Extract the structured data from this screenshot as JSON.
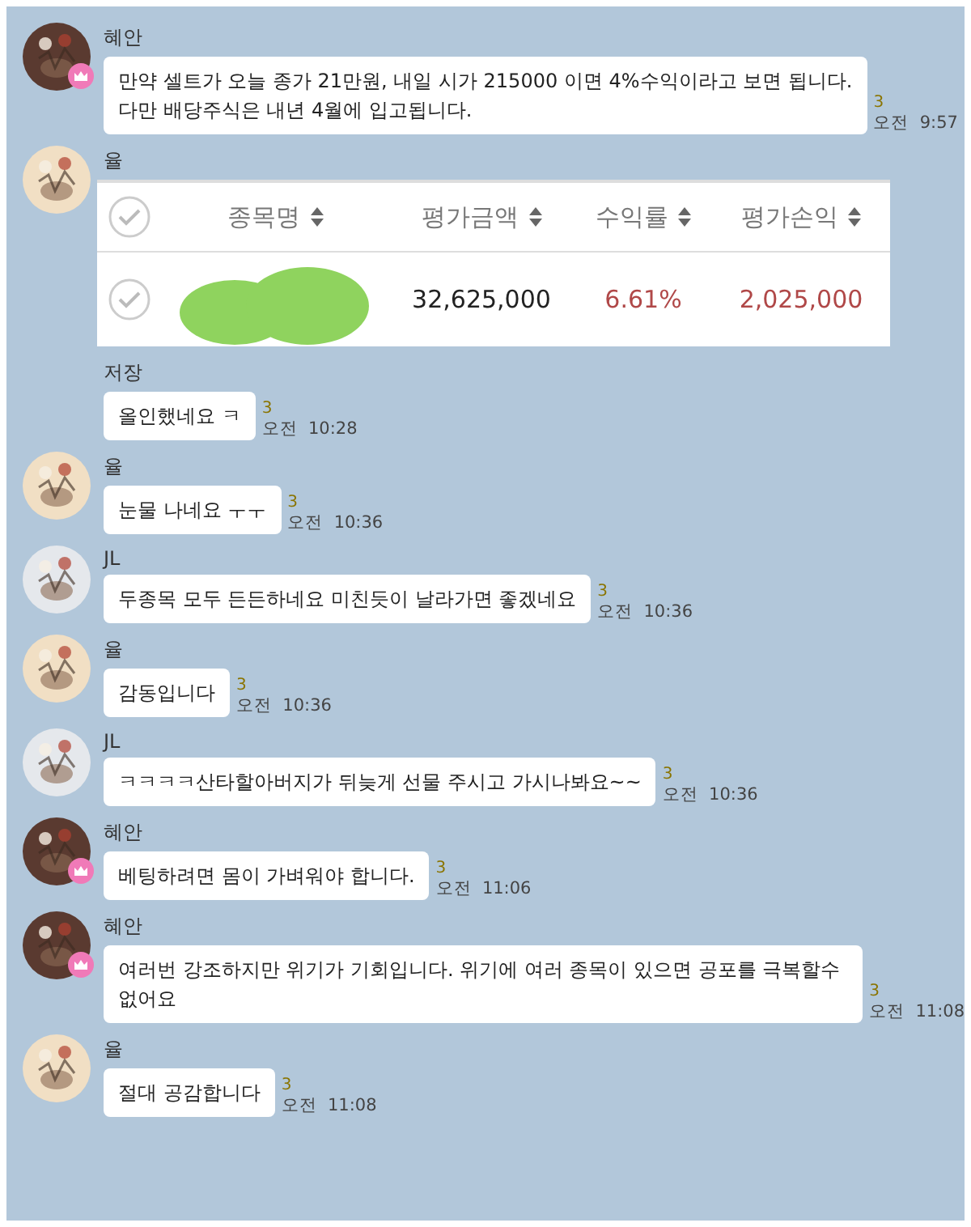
{
  "messages": [
    {
      "sender": "혜안",
      "avatar": {
        "color": "#5a3a30"
      },
      "crown": true,
      "kind": "text",
      "text": "만약 셀트가 오늘 종가 21만원, 내일 시가 215000 이면 4%수익이라고 보면 됩니다.\n다만 배당주식은 내년 4월에 입고됩니다.",
      "unread": "3",
      "time": "오전  9:57"
    },
    {
      "sender": "율",
      "avatar": {
        "color": "#f1dfc4"
      },
      "crown": false,
      "table": {
        "columns": [
          "종목명",
          "평가금액",
          "수익률",
          "평가손익"
        ],
        "row": [
          "32,625,000",
          "6.61%",
          "2,025,000"
        ]
      }
    },
    {
      "sender": "저장",
      "crown": false,
      "kind": "text",
      "text": "올인했네요 ㅋ",
      "unread": "3",
      "time": "오전  10:28"
    },
    {
      "sender": "율",
      "avatar": {
        "color": "#f1dfc4"
      },
      "crown": false,
      "kind": "text",
      "text": "눈물 나네요 ㅜㅜ",
      "unread": "3",
      "time": "오전  10:36"
    },
    {
      "sender": "JL",
      "avatar": {
        "color": "#e5e8ec"
      },
      "crown": false,
      "kind": "text",
      "text": "두종목 모두 든든하네요 미친듯이 날라가면 좋겠네요",
      "unread": "3",
      "time": "오전  10:36"
    },
    {
      "sender": "율",
      "avatar": {
        "color": "#f1dfc4"
      },
      "crown": false,
      "kind": "text",
      "text": "감동입니다",
      "unread": "3",
      "time": "오전  10:36"
    },
    {
      "sender": "JL",
      "avatar": {
        "color": "#e5e8ec"
      },
      "crown": false,
      "kind": "text",
      "text": "ㅋㅋㅋㅋ산타할아버지가 뒤늦게 선물 주시고 가시나봐요~~",
      "unread": "3",
      "time": "오전  10:36"
    },
    {
      "sender": "혜안",
      "avatar": {
        "color": "#5a3a30"
      },
      "crown": true,
      "kind": "text",
      "text": "베팅하려면 몸이 가벼워야 합니다.",
      "unread": "3",
      "time": "오전  11:06"
    },
    {
      "sender": "혜안",
      "avatar": {
        "color": "#5a3a30"
      },
      "crown": true,
      "kind": "text",
      "text": "여러번 강조하지만 위기가 기회입니다. 위기에 여러 종목이 있으면 공포를 극복할수 없어요",
      "unread": "3",
      "time": "오전  11:08"
    },
    {
      "sender": "율",
      "avatar": {
        "color": "#f1dfc4"
      },
      "crown": false,
      "kind": "text",
      "text": "절대 공감합니다",
      "unread": "3",
      "time": "오전  11:08"
    }
  ]
}
